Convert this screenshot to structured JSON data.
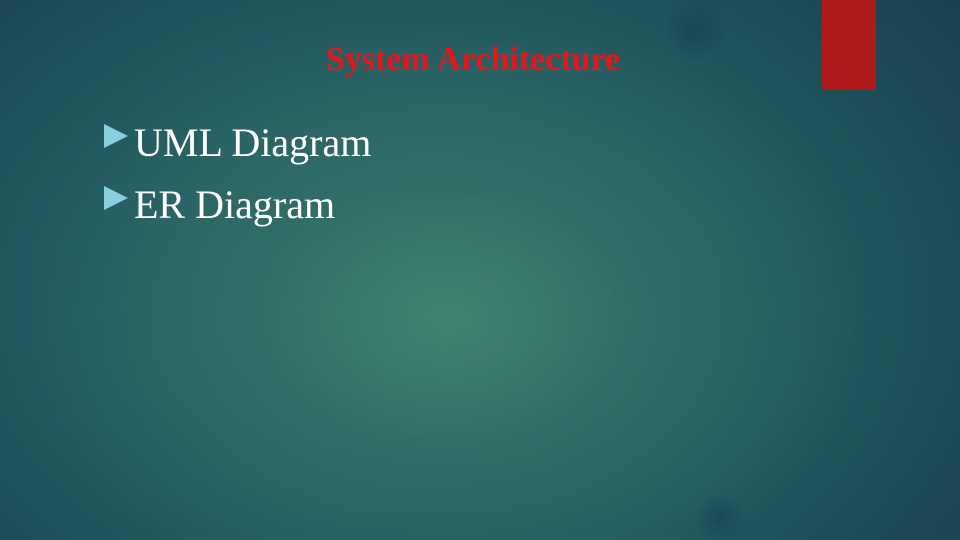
{
  "slide": {
    "title": "System Architecture",
    "bullets": [
      {
        "label": "UML Diagram",
        "icon": "arrow-right-icon"
      },
      {
        "label": "ER Diagram",
        "icon": "arrow-right-icon"
      }
    ]
  },
  "colors": {
    "title": "#e8141a",
    "accent_bar": "#b01a1c",
    "bullet_text": "#ffffff",
    "bullet_arrow": "#8ad0dc",
    "background_center": "#46877a",
    "background_edge": "#173f4c"
  }
}
